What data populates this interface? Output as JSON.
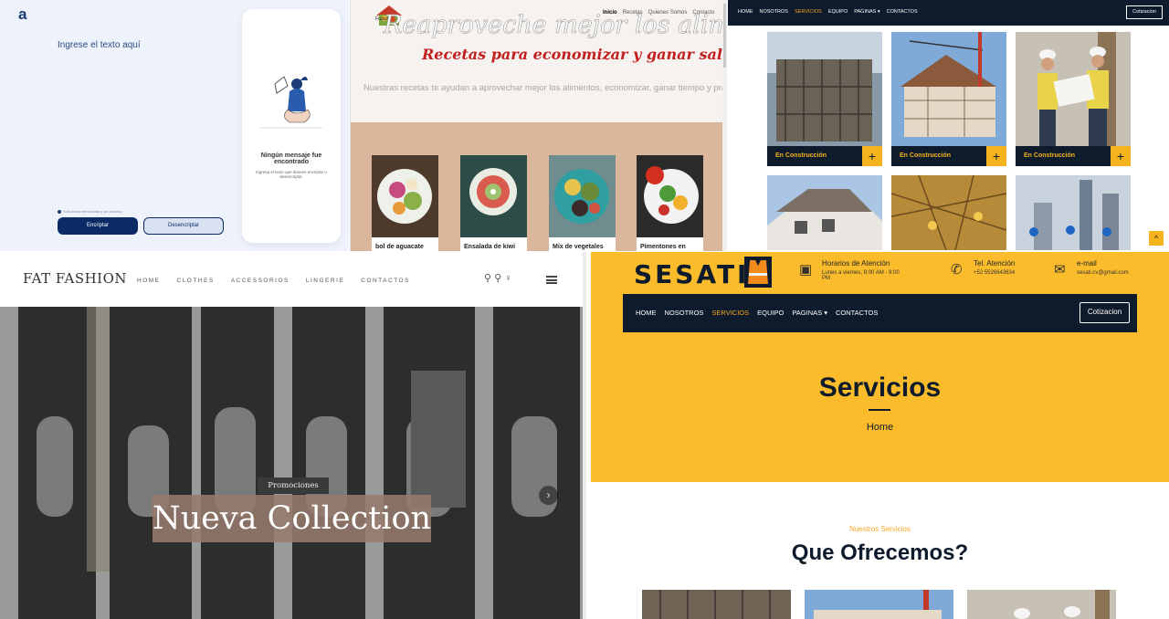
{
  "encryptor": {
    "logo": "a",
    "input_placeholder": "Ingrese el texto aquí",
    "note": "Solo letras minúsculas y sin acentos",
    "encrypt_label": "Encriptar",
    "decrypt_label": "Desencriptar",
    "empty_title": "Ningún mensaje fue encontrado",
    "empty_desc": "Ingresa el texto que desees encriptar o desencriptar."
  },
  "recipes": {
    "logo_text": "Frutas",
    "nav": [
      "Inicio",
      "Recetas",
      "Quienes Somos",
      "Contacto"
    ],
    "headline": "Reaproveche mejor los alimentos",
    "subheadline": "Recetas para economizar y ganar salud",
    "tagline": "Nuestras recetas te ayudan a aprovechar mejor los alimentos, economizar, ganar tiempo y practicidad",
    "cards": [
      "bol de aguacate",
      "Ensalada de kiwi",
      "Mix de vegetales",
      "Pimentones en"
    ]
  },
  "gallery": {
    "nav": [
      "HOME",
      "NOSOTROS",
      "SERVICIOS",
      "EQUIPO",
      "PAGINAS ▾",
      "CONTACTOS"
    ],
    "active": "SERVICIOS",
    "quote_button": "Cotizacion",
    "captions": [
      "En Construcción",
      "En Construcción",
      "En Construcción"
    ]
  },
  "fashion": {
    "brand": "FAT FASHION",
    "menu": [
      "HOME",
      "CLOTHES",
      "ACCESSORIOS",
      "LINGERIE",
      "CONTACTOS"
    ],
    "promo_label": "Promociones",
    "collection_title": "Nueva Collection"
  },
  "sesati": {
    "brand": "SESATI",
    "hours_title": "Horarios de Atención",
    "hours_detail": "Lunes a viernes, 8:00 AM - 9:00 PM",
    "phone_title": "Tel. Atención",
    "phone_number": "+52 5526643634",
    "email_title": "e-mail",
    "email_address": "sesati.cv@gmail.com",
    "nav": [
      "HOME",
      "NOSOTROS",
      "SERVICIOS",
      "EQUIPO",
      "PAGINAS ▾",
      "CONTACTOS"
    ],
    "active": "SERVICIOS",
    "quote_button": "Cotizacion",
    "page_title": "Servicios",
    "breadcrumb": "Home",
    "section_subtitle": "Nuestros Servicios",
    "section_title": "Que Ofrecemos?"
  },
  "colors": {
    "navy": "#0e1b2c",
    "amber": "#f5b31d",
    "sesati_yellow": "#fbbc2b",
    "recipe_red": "#c21f1f",
    "encrypt_blue": "#0b2b66"
  }
}
